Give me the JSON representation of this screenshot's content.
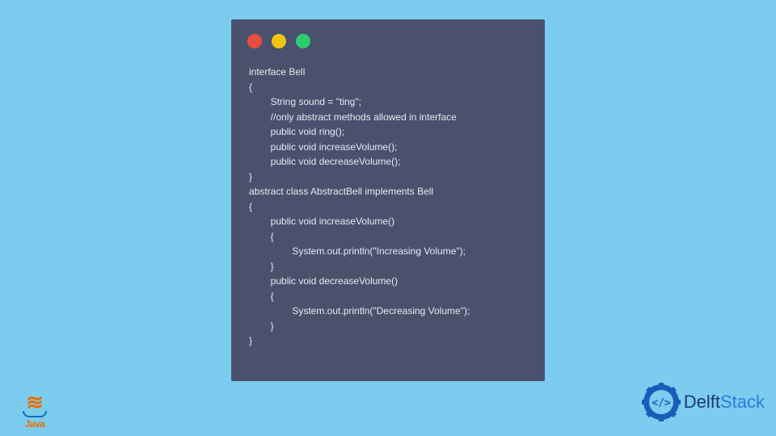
{
  "window": {
    "dots": [
      "red",
      "yellow",
      "green"
    ]
  },
  "code": {
    "lines": [
      "interface Bell",
      "{",
      "\tString sound = \"ting\";",
      "\t//only abstract methods allowed in interface",
      "\tpublic void ring();\t",
      "\tpublic void increaseVolume();",
      "\tpublic void decreaseVolume();",
      "}",
      "abstract class AbstractBell implements Bell",
      "{",
      "\tpublic void increaseVolume()",
      "\t{",
      "\t\tSystem.out.println(\"Increasing Volume\");",
      "\t}",
      "\tpublic void decreaseVolume()",
      "\t{",
      "\t\tSystem.out.println(\"Decreasing Volume\");",
      "\t}",
      "}"
    ]
  },
  "logos": {
    "java_label": "Java",
    "delft_part1": "Delft",
    "delft_part2": "Stack"
  }
}
